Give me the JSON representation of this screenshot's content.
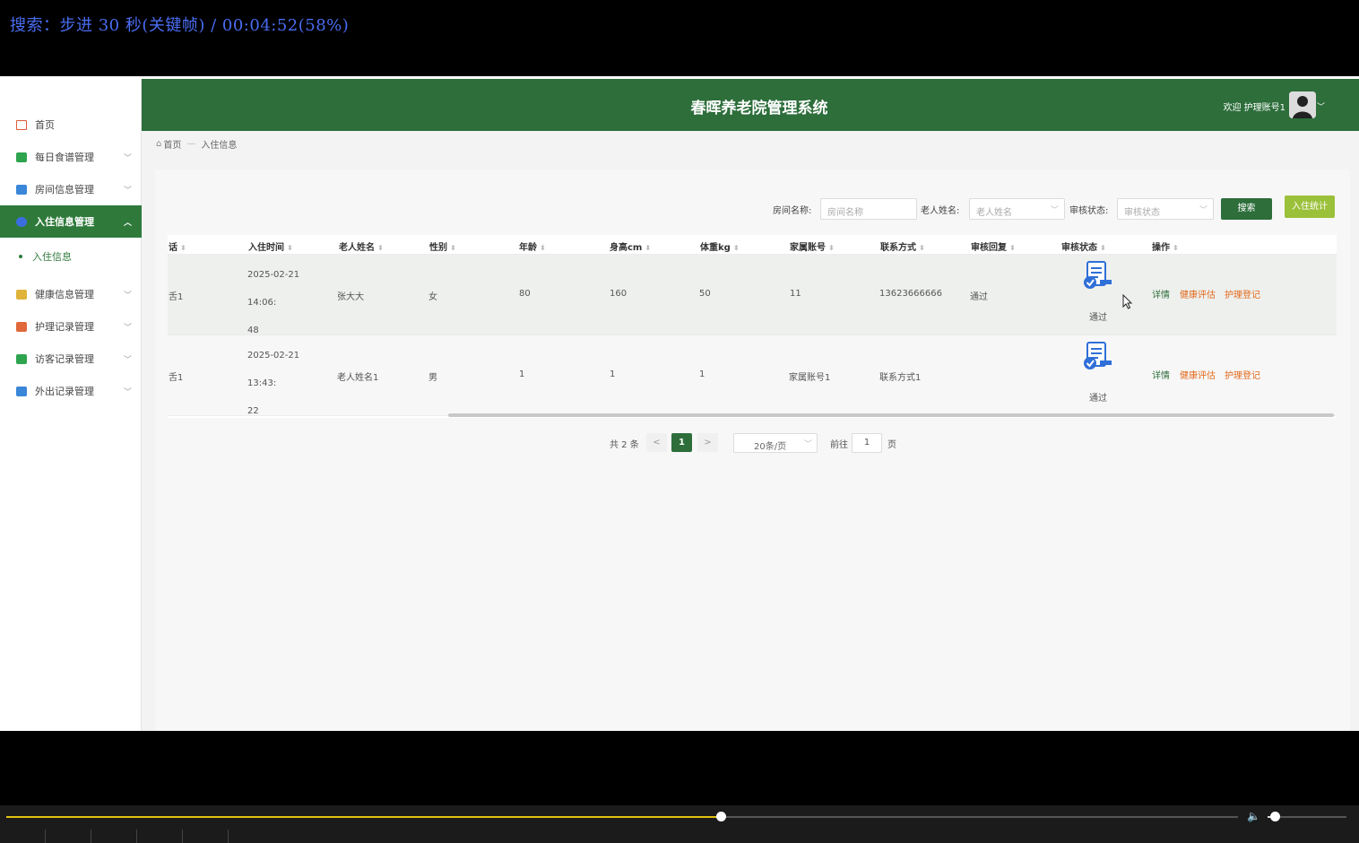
{
  "osd": {
    "text": "搜索：步进 30 秒(关键帧) / 00:04:52(58%)"
  },
  "header": {
    "title": "春晖养老院管理系统",
    "welcome": "欢迎 护理账号1"
  },
  "breadcrumb": {
    "home": "首页",
    "current": "入住信息"
  },
  "sidebar": {
    "items": [
      {
        "label": "首页",
        "icon": "home-icon",
        "color": "#e05a3a"
      },
      {
        "label": "每日食谱管理",
        "icon": "recipe-icon",
        "color": "#2ea44f"
      },
      {
        "label": "房间信息管理",
        "icon": "room-icon",
        "color": "#3a86d8"
      },
      {
        "label": "入住信息管理",
        "icon": "checkin-icon",
        "color": "#3a6ee0"
      },
      {
        "label": "健康信息管理",
        "icon": "health-icon",
        "color": "#e0b33a"
      },
      {
        "label": "护理记录管理",
        "icon": "nursing-icon",
        "color": "#e0683a"
      },
      {
        "label": "访客记录管理",
        "icon": "visitor-icon",
        "color": "#2ea44f"
      },
      {
        "label": "外出记录管理",
        "icon": "outing-icon",
        "color": "#3a86d8"
      }
    ],
    "sub_item": "入住信息"
  },
  "filters": {
    "room_label": "房间名称:",
    "room_placeholder": "房间名称",
    "elder_label": "老人姓名:",
    "elder_placeholder": "老人姓名",
    "audit_label": "审核状态:",
    "audit_placeholder": "审核状态",
    "search_button": "搜索",
    "stats_button": "入住统计"
  },
  "table": {
    "columns": [
      "话",
      "入住时间",
      "老人姓名",
      "性别",
      "年龄",
      "身高cm",
      "体重kg",
      "家属账号",
      "联系方式",
      "审核回复",
      "审核状态",
      "操作"
    ],
    "rows": [
      {
        "c0": "舌1",
        "time_a": "2025-02-21 14:06:",
        "time_b": "48",
        "name": "张大大",
        "gender": "女",
        "age": "80",
        "height": "160",
        "weight": "50",
        "family": "11",
        "phone": "13623666666",
        "reply": "通过",
        "status": "通过"
      },
      {
        "c0": "舌1",
        "time_a": "2025-02-21 13:43:",
        "time_b": "22",
        "name": "老人姓名1",
        "gender": "男",
        "age": "1",
        "height": "1",
        "weight": "1",
        "family": "家属账号1",
        "phone": "联系方式1",
        "reply": "",
        "status": "通过"
      }
    ],
    "actions": {
      "detail": "详情",
      "health": "健康评估",
      "nurse": "护理登记"
    }
  },
  "pagination": {
    "total": "共 2 条",
    "prev": "<",
    "current": "1",
    "next": ">",
    "page_size": "20条/页",
    "goto": "前往",
    "jump_value": "1",
    "page_suffix": "页"
  },
  "player": {
    "progress": 0.58,
    "volume": 0.09
  }
}
